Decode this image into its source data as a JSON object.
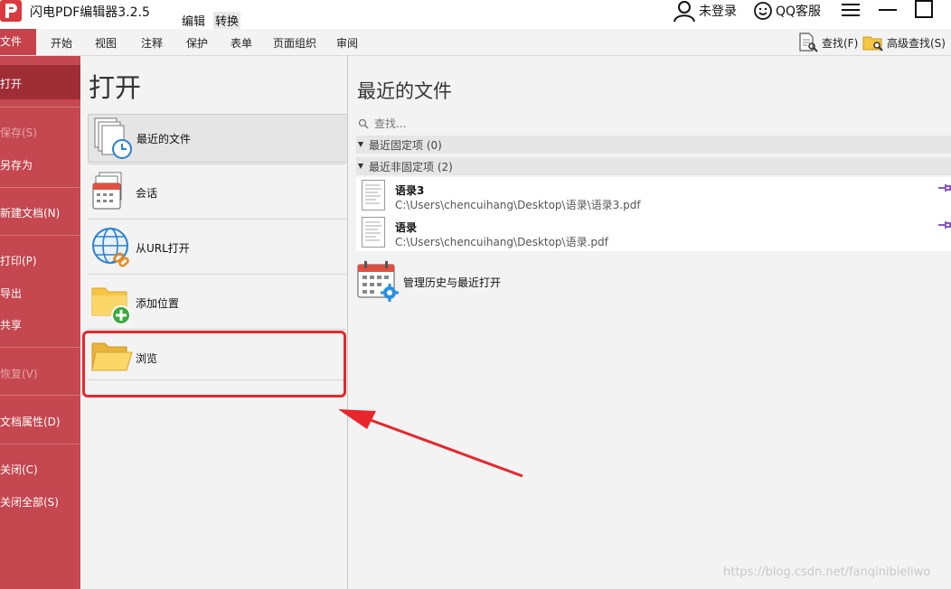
{
  "app": {
    "title": "闪电PDF编辑器3.2.5"
  },
  "title_tabs": [
    "编辑",
    "转换"
  ],
  "window_controls": {
    "user_label": "未登录",
    "qq_label": "QQ客服"
  },
  "ribbon": {
    "file_tab": "文件",
    "tabs": [
      "开始",
      "视图",
      "注释",
      "保护",
      "表单",
      "页面组织",
      "审阅"
    ],
    "find_label": "查找(F)",
    "advanced_find_label": "高级查找(S)"
  },
  "sidebar": {
    "items": [
      {
        "label": "打开",
        "enabled": true,
        "selected": true
      },
      {
        "label": "保存(S)",
        "enabled": false
      },
      {
        "label": "另存为",
        "enabled": true
      },
      {
        "label": "新建文档(N)",
        "enabled": true
      },
      {
        "label": "打印(P)",
        "enabled": true
      },
      {
        "label": "导出",
        "enabled": true
      },
      {
        "label": "共享",
        "enabled": true
      },
      {
        "label": "恢复(V)",
        "enabled": false
      },
      {
        "label": "文档属性(D)",
        "enabled": true
      },
      {
        "label": "关闭(C)",
        "enabled": true
      },
      {
        "label": "关闭全部(S)",
        "enabled": true
      }
    ]
  },
  "open_panel": {
    "title": "打开",
    "options": [
      {
        "label": "最近的文件",
        "icon": "recent-files-icon",
        "selected": true
      },
      {
        "label": "会话",
        "icon": "session-calendar-icon"
      },
      {
        "label": "从URL打开",
        "icon": "globe-link-icon"
      },
      {
        "label": "添加位置",
        "icon": "folder-add-icon"
      },
      {
        "label": "浏览",
        "icon": "folder-open-icon"
      }
    ]
  },
  "recent_panel": {
    "title": "最近的文件",
    "search_placeholder": "查找...",
    "pinned_header": "最近固定项 (0)",
    "unpinned_header": "最近非固定项 (2)",
    "files": [
      {
        "name": "语录3",
        "path": "C:\\Users\\chencuihang\\Desktop\\语录\\语录3.pdf"
      },
      {
        "name": "语录",
        "path": "C:\\Users\\chencuihang\\Desktop\\语录.pdf"
      }
    ],
    "manage_label": "管理历史与最近打开"
  },
  "watermark": "https://blog.csdn.net/fanqinibieliwo",
  "colors": {
    "brand_red": "#c5474f",
    "sidebar_selected": "#9f2d36",
    "highlight_red": "#e8262b",
    "pin_purple": "#8a55c4"
  }
}
